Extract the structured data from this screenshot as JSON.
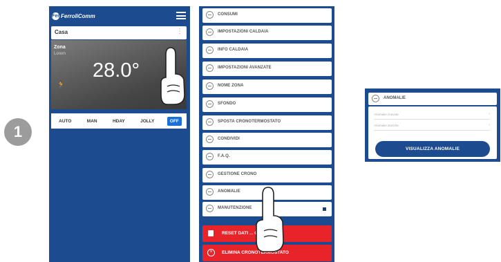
{
  "step": {
    "number": "1"
  },
  "screen1": {
    "logo_mark": "Fer",
    "logo_text": "FerroliComm",
    "house_label": "Casa",
    "house_menu": "⋮",
    "zone_name": "Zona",
    "zone_sub": "Lorem",
    "temperature": "28.0°",
    "modes": [
      "AUTO",
      "MAN",
      "HDAY",
      "JOLLY",
      "OFF"
    ],
    "active_mode": "OFF"
  },
  "screen2": {
    "menu_items": [
      "CONSUMI",
      "IMPOSTAZIONI CALDAIA",
      "INFO CALDAIA",
      "IMPOSTAZIONI AVANZATE",
      "NOME ZONA",
      "SFONDO",
      "SPOSTA CRONOTERMOSTATO",
      "CONDIVIDI",
      "F.A.Q.",
      "GESTIONE CRONO",
      "ANOMALIE",
      "MANUTENZIONE"
    ],
    "reset_label": "RESET DATI ... CA",
    "delete_label": "ELIMINA CRONOTERMOSTATO"
  },
  "panel3": {
    "header_label": "ANOMALIE",
    "field1": "Anomalie ricevute",
    "field2": "Anomalie storiche",
    "button_label": "VISUALIZZA ANOMALIE"
  },
  "colors": {
    "brand_blue": "#1c4b8f",
    "alert_red": "#e8232a",
    "active_blue": "#1c6fd6"
  }
}
